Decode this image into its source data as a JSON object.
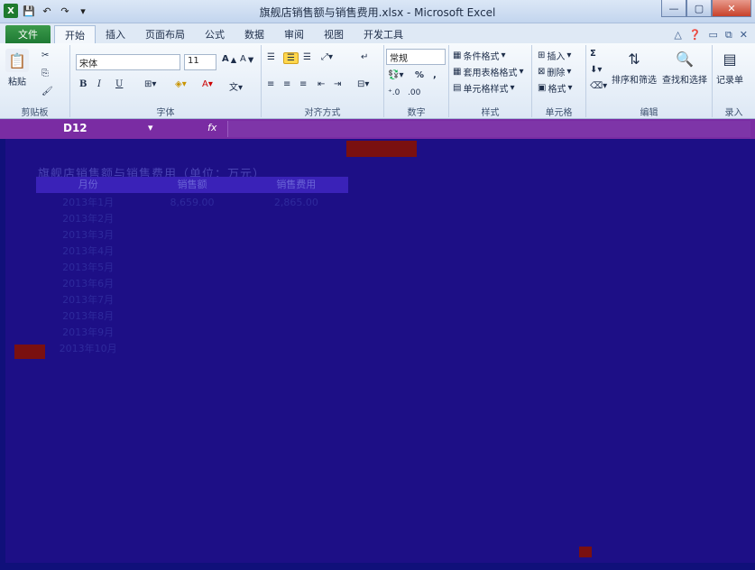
{
  "window": {
    "title": "旗舰店销售额与销售费用.xlsx - Microsoft Excel",
    "qat_icons": [
      "excel-logo-icon",
      "save-icon",
      "undo-icon",
      "redo-icon",
      "customize-icon"
    ]
  },
  "tabs": {
    "file": "文件",
    "items": [
      "开始",
      "插入",
      "页面布局",
      "公式",
      "数据",
      "审阅",
      "视图",
      "开发工具"
    ],
    "active_index": 0
  },
  "ribbon": {
    "clipboard": {
      "label": "剪贴板",
      "paste": "粘贴"
    },
    "font": {
      "label": "字体",
      "name": "宋体",
      "size": "11",
      "bold": "B",
      "italic": "I",
      "underline": "U"
    },
    "alignment": {
      "label": "对齐方式"
    },
    "number": {
      "label": "数字",
      "format": "常规",
      "percent": "%",
      "comma": ","
    },
    "styles": {
      "label": "样式",
      "conditional": "条件格式",
      "table": "套用表格格式",
      "cell": "单元格样式"
    },
    "cells": {
      "label": "单元格",
      "insert": "插入",
      "delete": "删除",
      "format": "格式"
    },
    "editing": {
      "label": "编辑",
      "sort_filter": "排序和筛选",
      "find_select": "查找和选择",
      "sum": "Σ"
    },
    "record": {
      "label": "录入",
      "record_sheet": "记录单"
    }
  },
  "formula_bar": {
    "name_box": "D12",
    "fx": "fx",
    "value": ""
  },
  "sheet": {
    "title": "旗舰店销售额与销售费用（单位：万元）",
    "headers": [
      "月份",
      "销售额",
      "销售费用"
    ],
    "rows": [
      [
        "2013年1月",
        "8,659.00",
        "2,865.00"
      ],
      [
        "2013年2月",
        "",
        ""
      ],
      [
        "2013年3月",
        "",
        ""
      ],
      [
        "2013年4月",
        "",
        ""
      ],
      [
        "2013年5月",
        "",
        ""
      ],
      [
        "2013年6月",
        "",
        ""
      ],
      [
        "2013年7月",
        "",
        ""
      ],
      [
        "2013年8月",
        "",
        ""
      ],
      [
        "2013年9月",
        "",
        ""
      ],
      [
        "2013年10月",
        "",
        ""
      ]
    ]
  }
}
